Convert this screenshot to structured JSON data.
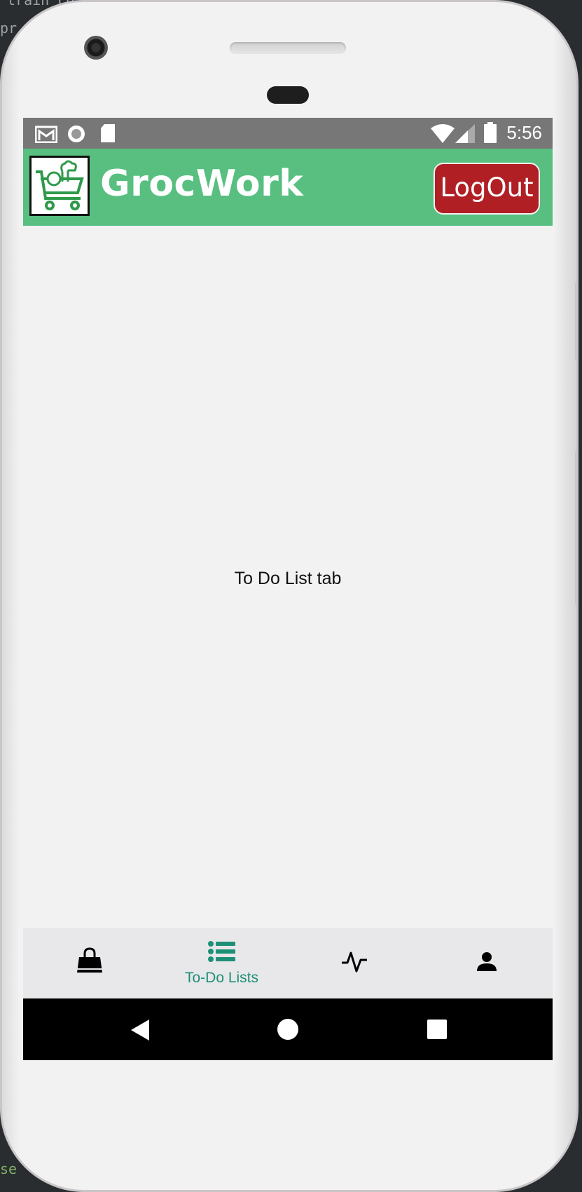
{
  "background": {
    "snippet_top": "train_co",
    "snippet_left": "pr",
    "snippet_bottom": "se"
  },
  "status_bar": {
    "time": "5:56",
    "icons": [
      "gmail-icon",
      "circle-record-icon",
      "sd-card-icon",
      "wifi-icon",
      "signal-icon",
      "battery-icon"
    ]
  },
  "app_bar": {
    "title": "GrocWork",
    "logout_label": "LogOut",
    "color": "#58bf80",
    "logout_color": "#b01f24"
  },
  "content": {
    "message": "To Do List tab"
  },
  "bottom_nav": {
    "active_color": "#1d9077",
    "tabs": [
      {
        "icon": "shopping-bag-icon",
        "label": ""
      },
      {
        "icon": "list-icon",
        "label": "To-Do Lists",
        "active": true
      },
      {
        "icon": "activity-icon",
        "label": ""
      },
      {
        "icon": "person-icon",
        "label": ""
      }
    ]
  },
  "system_nav": {
    "buttons": [
      "back-icon",
      "home-icon",
      "recents-icon"
    ]
  }
}
